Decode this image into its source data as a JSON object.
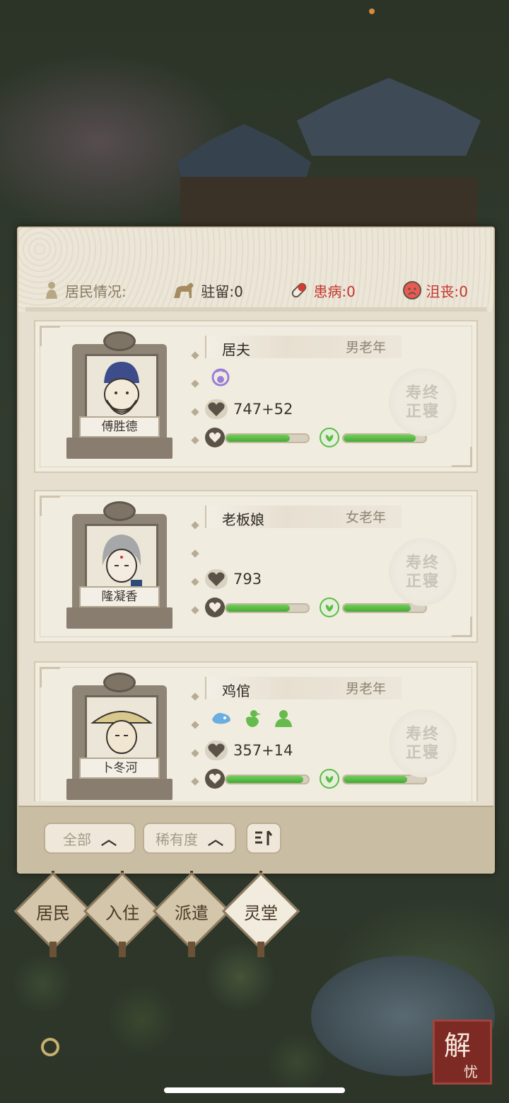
{
  "status": {
    "residents_label": "居民情况:",
    "stay": "驻留:0",
    "sick": "患病:0",
    "depressed": "沮丧:0"
  },
  "residents": [
    {
      "name": "傅胜德",
      "occupation": "居夫",
      "gender_age": "男老年",
      "traits": [
        "purple-trait-icon"
      ],
      "score": "747+52",
      "health": 0.78,
      "mood": 0.88,
      "stamp": "寿终正寝"
    },
    {
      "name": "隆凝香",
      "occupation": "老板娘",
      "gender_age": "女老年",
      "traits": [],
      "score": "793",
      "health": 0.78,
      "mood": 0.82,
      "stamp": "寿终正寝"
    },
    {
      "name": "卜冬河",
      "occupation": "鸡倌",
      "gender_age": "男老年",
      "traits": [
        "blue-trait-icon",
        "chicken-icon",
        "green-trait-icon"
      ],
      "score": "357+14",
      "health": 0.94,
      "mood": 0.78,
      "stamp": "寿终正寝"
    }
  ],
  "filters": {
    "category": "全部",
    "sort_by": "稀有度"
  },
  "nav": {
    "residents": "居民",
    "move_in": "入住",
    "dispatch": "派遣",
    "spirit_hall": "灵堂"
  },
  "corner_badge": {
    "big": "解",
    "small": "忧"
  },
  "colors": {
    "panel_bg": "#e6dfcf",
    "card_bg": "#f1ece0",
    "bar_green": "#5bbd45",
    "sick_red": "#c4362e"
  }
}
